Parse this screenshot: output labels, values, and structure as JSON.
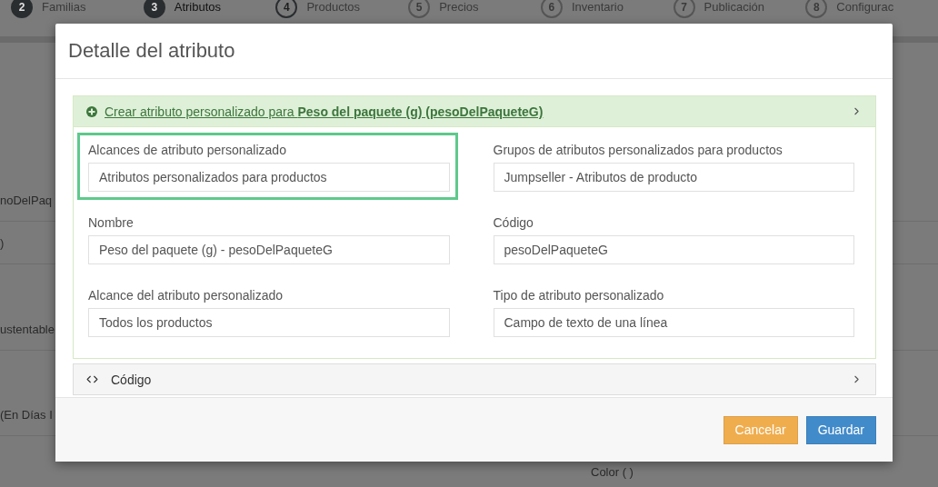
{
  "steps": [
    {
      "number": "2",
      "label": "Familias",
      "completed": true,
      "selected": false
    },
    {
      "number": "3",
      "label": "Atributos",
      "completed": true,
      "selected": true
    },
    {
      "number": "4",
      "label": "Productos",
      "completed": false,
      "selected": false
    },
    {
      "number": "5",
      "label": "Precios",
      "completed": false,
      "selected": false
    },
    {
      "number": "6",
      "label": "Inventario",
      "completed": false,
      "selected": false
    },
    {
      "number": "7",
      "label": "Publicación",
      "completed": false,
      "selected": false
    },
    {
      "number": "8",
      "label": "Configurac",
      "completed": false,
      "selected": false
    }
  ],
  "background_rows": [
    "noDelPaq",
    ")",
    "ustentable",
    "(En Días I"
  ],
  "background_field": "Color ( )",
  "modal": {
    "title": "Detalle del atributo",
    "create_panel": {
      "link": "Crear atributo personalizado para **Peso del paquete (g) (pesoDelPaqueteG)**",
      "expanded": true,
      "fields": [
        {
          "label": "Alcances de atributo personalizado",
          "value": "Atributos personalizados para productos",
          "highlighted": true
        },
        {
          "label": "Grupos de atributos personalizados para productos",
          "value": "Jumpseller - Atributos de producto",
          "highlighted": false
        },
        {
          "label": "Nombre",
          "value": "Peso del paquete (g) - pesoDelPaqueteG",
          "highlighted": false
        },
        {
          "label": "Código",
          "value": "pesoDelPaqueteG",
          "highlighted": false
        },
        {
          "label": "Alcance del atributo personalizado",
          "value": "Todos los productos",
          "highlighted": false
        },
        {
          "label": "Tipo de atributo personalizado",
          "value": "Campo de texto de una línea",
          "highlighted": false
        }
      ]
    },
    "code_panel": {
      "label": "Código",
      "expanded": false
    },
    "buttons": [
      {
        "label": "Cancelar",
        "kind": "warning"
      },
      {
        "label": "Guardar",
        "kind": "primary"
      }
    ]
  }
}
